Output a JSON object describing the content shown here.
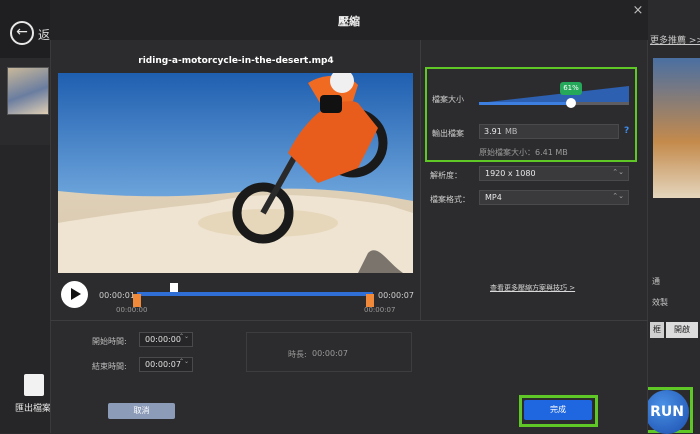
{
  "background_app": {
    "back_symbol": "←",
    "back_label": "返回",
    "right_link": "更多推薦 >>",
    "export_label": "匯出檔案格",
    "right_item1": "通",
    "right_item2": "效製",
    "btn_a": "框",
    "btn_b": "開啟",
    "run_label": "RUN"
  },
  "modal": {
    "title": "壓縮",
    "close_symbol": "×"
  },
  "video": {
    "file_name": "riding-a-motorcycle-in-the-desert.mp4"
  },
  "timeline": {
    "current_time": "00:00:01",
    "end_time": "00:00:07",
    "range_start": "00:00:00",
    "range_end": "00:00:07"
  },
  "trim": {
    "start_label": "開始時間:",
    "start_value": "00:00:00",
    "end_label": "結束時間:",
    "end_value": "00:00:07",
    "duration_label": "時長:",
    "duration_value": "00:00:07",
    "spin_symbol": "⌃⌄"
  },
  "settings": {
    "size_label": "檔案大小",
    "percent": "61%",
    "slider_level": 0.61,
    "output_label": "輸出檔案",
    "output_value": "3.91",
    "output_unit": "MB",
    "help_symbol": "?",
    "original_size": "原始檔案大小：6.41 MB",
    "resolution_label": "解析度：",
    "resolution_value": "1920 x 1080",
    "format_label": "檔案格式：",
    "format_value": "MP4",
    "caret_symbol": "⌃⌄",
    "more_link": "查看更多壓縮方案與技巧 >"
  },
  "footer": {
    "cancel_label": "取消",
    "done_label": "完成"
  },
  "colors": {
    "accent_blue": "#1f67e0",
    "highlight_green": "#5fc826",
    "trim_orange": "#f08a3a",
    "badge_green": "#25a85a"
  },
  "icons": {
    "back": "arrow-left-icon",
    "close": "close-icon",
    "play": "play-icon",
    "help": "question-icon",
    "export": "export-file-icon"
  }
}
